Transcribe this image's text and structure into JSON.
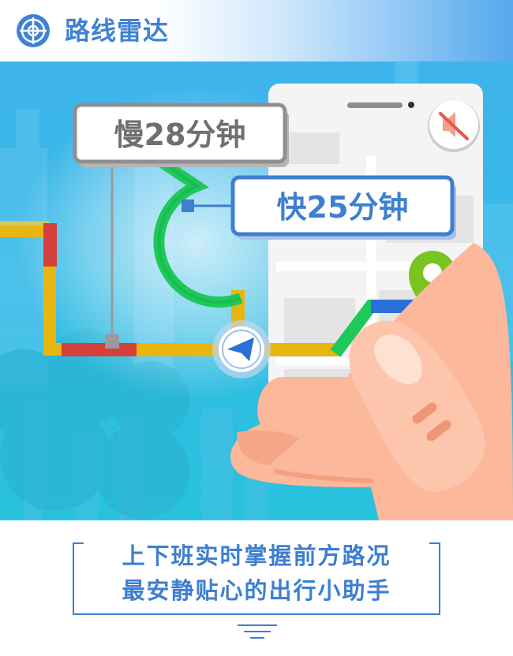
{
  "header": {
    "title": "路线雷达",
    "icon": "radar-target-icon"
  },
  "illustration": {
    "slow_label": "慢28分钟",
    "fast_label": "快25分钟",
    "icons": [
      "mute-speaker-icon",
      "location-pin-icon",
      "navigation-arrow-icon"
    ],
    "colors": {
      "sky": "#38b6ea",
      "fast_route": "#1ec95a",
      "slow_route_red": "#d5403a",
      "slow_route_yellow": "#e8b60f",
      "accent_blue": "#3d7fd0",
      "phone": "#f4f4f4",
      "hand": "#fbb89b"
    }
  },
  "tagline": {
    "line1": "上下班实时掌握前方路况",
    "line2": "最安静贴心的出行小助手"
  }
}
